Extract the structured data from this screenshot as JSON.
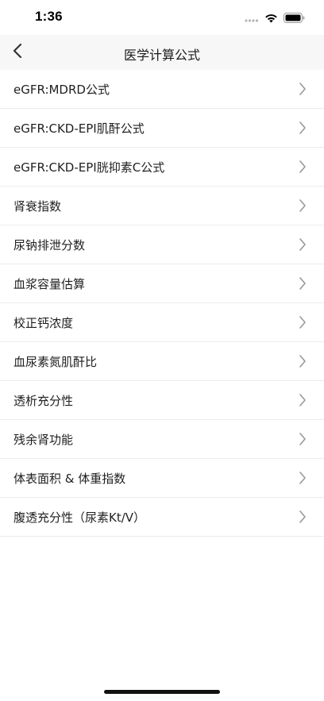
{
  "status_bar": {
    "time": "1:36",
    "icons": [
      "signal-dots-icon",
      "wifi-icon",
      "battery-icon"
    ]
  },
  "nav": {
    "title": "医学计算公式",
    "back_icon": "chevron-left-icon"
  },
  "items": [
    {
      "label": "eGFR:MDRD公式"
    },
    {
      "label": "eGFR:CKD-EPI肌酐公式"
    },
    {
      "label": "eGFR:CKD-EPI胱抑素C公式"
    },
    {
      "label": "肾衰指数"
    },
    {
      "label": "尿钠排泄分数"
    },
    {
      "label": "血浆容量估算"
    },
    {
      "label": "校正钙浓度"
    },
    {
      "label": "血尿素氮肌酐比"
    },
    {
      "label": "透析充分性"
    },
    {
      "label": "残余肾功能"
    },
    {
      "label": "体表面积 & 体重指数"
    },
    {
      "label": "腹透充分性（尿素Kt/V）"
    }
  ],
  "colors": {
    "nav_background": "#f7f7f7",
    "separator": "#ececec",
    "chevron": "#9a9a9a"
  }
}
